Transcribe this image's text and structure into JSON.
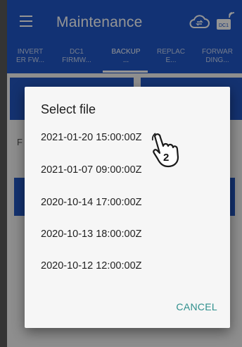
{
  "app": {
    "title": "Maintenance"
  },
  "tabs": [
    {
      "label_line1": "INVERT",
      "label_line2": "ER FW..."
    },
    {
      "label_line1": "DC1",
      "label_line2": "FIRMW..."
    },
    {
      "label_line1": "BACKUP",
      "label_line2": "..."
    },
    {
      "label_line1": "REPLAC",
      "label_line2": "E..."
    },
    {
      "label_line1": "FORWAR",
      "label_line2": "DING..."
    }
  ],
  "background": {
    "partial_label": "F"
  },
  "dialog": {
    "title": "Select file",
    "files": [
      "2021-01-20 15:00:00Z",
      "2021-01-07 09:00:00Z",
      "2020-10-14 17:00:00Z",
      "2020-10-13 18:00:00Z",
      "2020-10-12 12:00:00Z"
    ],
    "cancel_label": "CANCEL"
  },
  "callout": {
    "step_number": "2"
  },
  "colors": {
    "primary": "#1f56c9",
    "accent": "#2e8f8c"
  }
}
